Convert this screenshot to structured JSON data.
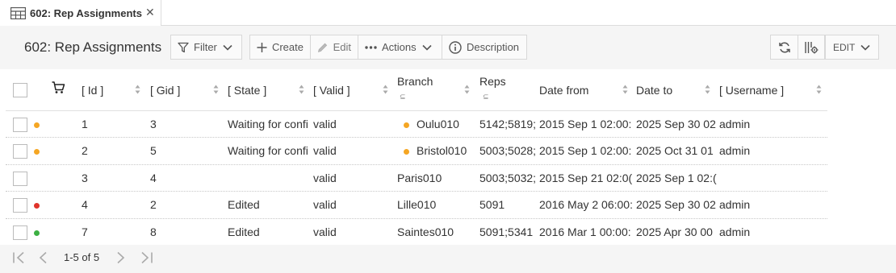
{
  "tab": {
    "label": "602: Rep Assignments",
    "icon": "table-icon"
  },
  "toolbar": {
    "title": "602: Rep Assignments",
    "filter_label": "Filter",
    "create_label": "Create",
    "edit_label": "Edit",
    "actions_label": "Actions",
    "description_label": "Description",
    "edit_mode_label": "EDIT"
  },
  "grid": {
    "columns": {
      "id": "[ Id ]",
      "gid": "[ Gid ]",
      "state": "[ State ]",
      "valid": "[ Valid ]",
      "branch": "Branch",
      "reps": "Reps",
      "date_from": "Date from",
      "date_to": "Date to",
      "username": "[ Username ]"
    },
    "rows": [
      {
        "status_color": "#f5a623",
        "id": "1",
        "gid": "3",
        "state": "Waiting for confi",
        "valid": "valid",
        "branch_dot": "#f5a623",
        "branch": "Oulu010",
        "reps": "5142;5819;",
        "date_from": "2015 Sep 1 02:00:",
        "date_to": "2025 Sep 30 02",
        "username": "admin"
      },
      {
        "status_color": "#f5a623",
        "id": "2",
        "gid": "5",
        "state": "Waiting for confi",
        "valid": "valid",
        "branch_dot": "#f5a623",
        "branch": "Bristol010",
        "reps": "5003;5028;",
        "date_from": "2015 Sep 1 02:00:",
        "date_to": "2025 Oct 31 01",
        "username": "admin"
      },
      {
        "status_color": "",
        "id": "3",
        "gid": "4",
        "state": "",
        "valid": "valid",
        "branch_dot": "",
        "branch": "Paris010",
        "reps": "5003;5032;",
        "date_from": "2015 Sep 21 02:0(",
        "date_to": "2025 Sep 1 02:(",
        "username": ""
      },
      {
        "status_color": "#e0342b",
        "id": "4",
        "gid": "2",
        "state": "Edited",
        "valid": "valid",
        "branch_dot": "",
        "branch": "Lille010",
        "reps": "5091",
        "date_from": "2016 May 2 06:00:",
        "date_to": "2025 Sep 30 02",
        "username": "admin"
      },
      {
        "status_color": "#3cb043",
        "id": "7",
        "gid": "8",
        "state": "Edited",
        "valid": "valid",
        "branch_dot": "",
        "branch": "Saintes010",
        "reps": "5091;5341",
        "date_from": "2016 Mar 1 00:00:",
        "date_to": "2025 Apr 30 00",
        "username": "admin"
      }
    ]
  },
  "pager": {
    "info": "1-5 of 5"
  }
}
